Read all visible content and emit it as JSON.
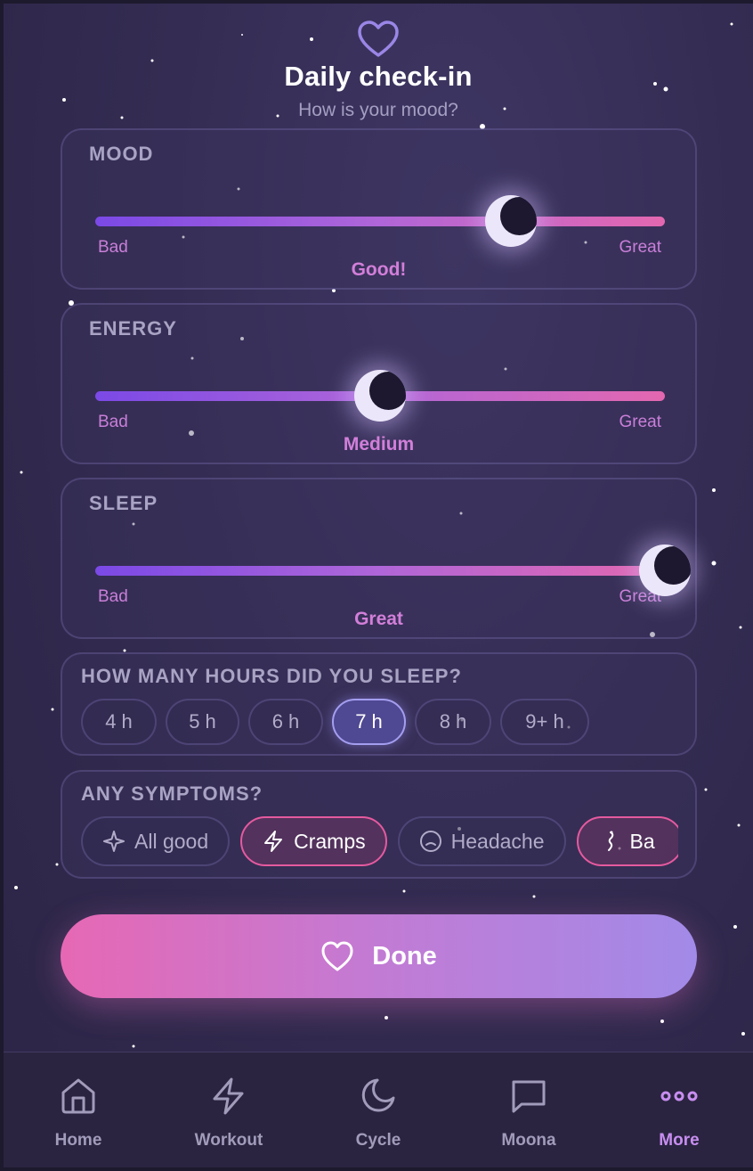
{
  "header": {
    "title": "Daily check-in",
    "subtitle": "How is your mood?"
  },
  "sliders": [
    {
      "key": "mood",
      "label": "MOOD",
      "min_label": "Bad",
      "max_label": "Great",
      "value_label": "Good!",
      "value": 0.73
    },
    {
      "key": "energy",
      "label": "ENERGY",
      "min_label": "Bad",
      "max_label": "Great",
      "value_label": "Medium",
      "value": 0.5
    },
    {
      "key": "sleep",
      "label": "SLEEP",
      "min_label": "Bad",
      "max_label": "Great",
      "value_label": "Great",
      "value": 1.0
    }
  ],
  "sleep_hours": {
    "label": "HOW MANY HOURS DID YOU SLEEP?",
    "options": [
      "4 h",
      "5 h",
      "6 h",
      "7 h",
      "8 h",
      "9+ h"
    ],
    "selected": "7 h"
  },
  "symptoms": {
    "label": "ANY SYMPTOMS?",
    "options": [
      {
        "label": "All good",
        "icon": "sparkle-icon"
      },
      {
        "label": "Cramps",
        "icon": "lightning-icon"
      },
      {
        "label": "Headache",
        "icon": "frown-icon"
      },
      {
        "label": "Ba",
        "icon": "back-pain-icon"
      }
    ],
    "selected": [
      "Cramps",
      "Ba"
    ]
  },
  "done_button": {
    "label": "Done",
    "icon": "heart-icon"
  },
  "nav": {
    "items": [
      {
        "label": "Home",
        "icon": "home-icon"
      },
      {
        "label": "Workout",
        "icon": "lightning-icon"
      },
      {
        "label": "Cycle",
        "icon": "moon-icon"
      },
      {
        "label": "Moona",
        "icon": "chat-bubble-icon"
      },
      {
        "label": "More",
        "icon": "more-dots-icon"
      }
    ],
    "active": "More"
  },
  "colors": {
    "background": "#342c52",
    "accent_pink": "#e668b4",
    "accent_purple": "#a28ae8",
    "value_label": "#d27fd9",
    "active_nav": "#c88ef0"
  }
}
